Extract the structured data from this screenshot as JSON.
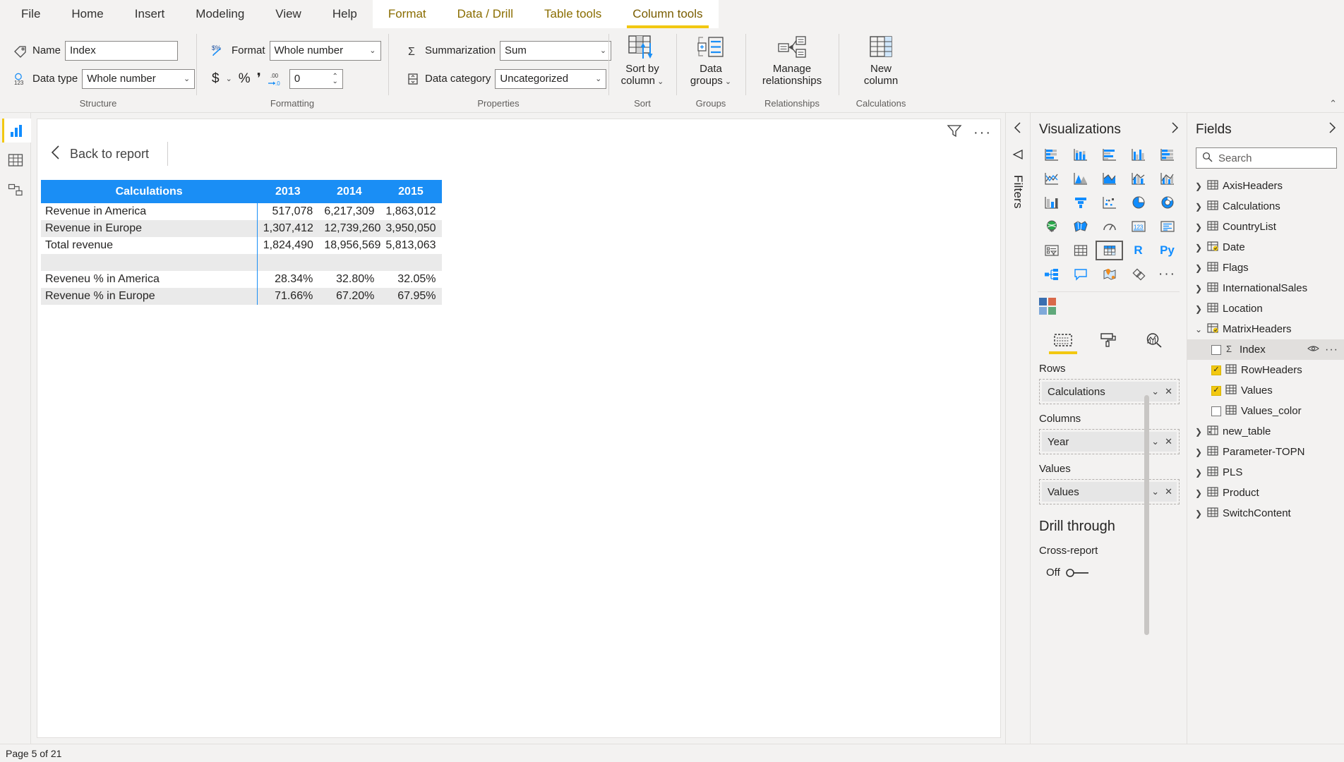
{
  "ribbon": {
    "tabs": [
      {
        "label": "File",
        "type": "normal",
        "active": false
      },
      {
        "label": "Home",
        "type": "normal",
        "active": false
      },
      {
        "label": "Insert",
        "type": "normal",
        "active": false
      },
      {
        "label": "Modeling",
        "type": "normal",
        "active": false
      },
      {
        "label": "View",
        "type": "normal",
        "active": false
      },
      {
        "label": "Help",
        "type": "normal",
        "active": false
      },
      {
        "label": "Format",
        "type": "contextual",
        "active": false
      },
      {
        "label": "Data / Drill",
        "type": "contextual",
        "active": false
      },
      {
        "label": "Table tools",
        "type": "contextual",
        "active": false
      },
      {
        "label": "Column tools",
        "type": "contextual",
        "active": true
      }
    ],
    "groups": {
      "structure": {
        "label": "Structure",
        "name_label": "Name",
        "name_value": "Index",
        "datatype_label": "Data type",
        "datatype_value": "Whole number"
      },
      "formatting": {
        "label": "Formatting",
        "format_label": "Format",
        "format_value": "Whole number",
        "currency_glyph": "$",
        "percent_glyph": "%",
        "thousands_glyph": "'",
        "decimal_glyph": ".00",
        "decimal_places_value": "0"
      },
      "properties": {
        "label": "Properties",
        "summarization_label": "Summarization",
        "summarization_value": "Sum",
        "datacategory_label": "Data category",
        "datacategory_value": "Uncategorized"
      },
      "sort": {
        "label": "Sort",
        "button_line1": "Sort by",
        "button_line2": "column"
      },
      "groups": {
        "label": "Groups",
        "button_line1": "Data",
        "button_line2": "groups"
      },
      "relationships": {
        "label": "Relationships",
        "button_line1": "Manage",
        "button_line2": "relationships"
      },
      "calculations": {
        "label": "Calculations",
        "button_line1": "New",
        "button_line2": "column"
      }
    }
  },
  "canvas": {
    "back_label": "Back to report",
    "matrix": {
      "headers": [
        "Calculations",
        "2013",
        "2014",
        "2015"
      ],
      "rows": [
        {
          "label": "Revenue in America",
          "values": [
            "517,078",
            "6,217,309",
            "1,863,012"
          ],
          "alt": false
        },
        {
          "label": "Revenue in Europe",
          "values": [
            "1,307,412",
            "12,739,260",
            "3,950,050"
          ],
          "alt": true
        },
        {
          "label": "Total revenue",
          "values": [
            "1,824,490",
            "18,956,569",
            "5,813,063"
          ],
          "alt": false
        },
        {
          "label": "",
          "values": [
            "",
            "",
            ""
          ],
          "alt": true
        },
        {
          "label": "Reveneu % in America",
          "values": [
            "28.34%",
            "32.80%",
            "32.05%"
          ],
          "alt": false
        },
        {
          "label": "Revenue % in Europe",
          "values": [
            "71.66%",
            "67.20%",
            "67.95%"
          ],
          "alt": true
        }
      ],
      "header_bg": "#1a8ef5",
      "alt_row_bg": "#eaeaea"
    }
  },
  "filters": {
    "label": "Filters"
  },
  "visualizations": {
    "title": "Visualizations",
    "icons": [
      "stacked-bar-chart-icon",
      "stacked-column-chart-icon",
      "clustered-bar-chart-icon",
      "clustered-column-chart-icon",
      "100-stacked-bar-chart-icon",
      "line-chart-icon",
      "area-chart-icon",
      "stacked-area-chart-icon",
      "line-and-stacked-column-chart-icon",
      "line-and-clustered-column-chart-icon",
      "ribbon-chart-icon",
      "waterfall-chart-icon",
      "scatter-chart-icon",
      "pie-chart-icon",
      "donut-chart-icon",
      "map-icon",
      "filled-map-icon",
      "gauge-icon",
      "card-icon",
      "multi-row-card-icon",
      "slicer-icon",
      "table-icon",
      "matrix-icon",
      "r-script-visual-icon",
      "python-visual-icon",
      "decomposition-tree-icon",
      "q-and-a-icon",
      "arcgis-map-icon",
      "paginated-report-icon",
      "more-visuals-icon"
    ],
    "selected_icon": "matrix-icon",
    "theme_label": "color-theme-swatch-icon",
    "field_tabs": [
      {
        "name": "fields-tab",
        "icon": "fields-well-icon",
        "active": true
      },
      {
        "name": "format-tab",
        "icon": "paint-roller-icon",
        "active": false
      },
      {
        "name": "analytics-tab",
        "icon": "analytics-magnifier-icon",
        "active": false
      }
    ],
    "wells": [
      {
        "label": "Rows",
        "chip": "Calculations"
      },
      {
        "label": "Columns",
        "chip": "Year"
      },
      {
        "label": "Values",
        "chip": "Values"
      }
    ],
    "drill": {
      "title": "Drill through",
      "cross_report_label": "Cross-report",
      "toggle_state": "Off"
    }
  },
  "fields": {
    "title": "Fields",
    "search_placeholder": "Search",
    "items": [
      {
        "label": "AxisHeaders",
        "level": 0,
        "expanded": false,
        "icon": "table-icon",
        "checked": null
      },
      {
        "label": "Calculations",
        "level": 0,
        "expanded": false,
        "icon": "table-icon",
        "checked": null
      },
      {
        "label": "CountryList",
        "level": 0,
        "expanded": false,
        "icon": "table-icon",
        "checked": null
      },
      {
        "label": "Date",
        "level": 0,
        "expanded": false,
        "icon": "date-table-icon",
        "checked": null
      },
      {
        "label": "Flags",
        "level": 0,
        "expanded": false,
        "icon": "table-icon",
        "checked": null
      },
      {
        "label": "InternationalSales",
        "level": 0,
        "expanded": false,
        "icon": "table-icon",
        "checked": null
      },
      {
        "label": "Location",
        "level": 0,
        "expanded": false,
        "icon": "table-icon",
        "checked": null
      },
      {
        "label": "MatrixHeaders",
        "level": 0,
        "expanded": true,
        "icon": "checked-table-icon",
        "checked": null
      },
      {
        "label": "Index",
        "level": 1,
        "expanded": null,
        "icon": "sigma-icon",
        "checked": false,
        "selected": true,
        "actions": true
      },
      {
        "label": "RowHeaders",
        "level": 1,
        "expanded": null,
        "icon": "column-icon",
        "checked": true
      },
      {
        "label": "Values",
        "level": 1,
        "expanded": null,
        "icon": "column-icon",
        "checked": true
      },
      {
        "label": "Values_color",
        "level": 1,
        "expanded": null,
        "icon": "column-icon",
        "checked": false
      },
      {
        "label": "new_table",
        "level": 0,
        "expanded": false,
        "icon": "calc-table-icon",
        "checked": null
      },
      {
        "label": "Parameter-TOPN",
        "level": 0,
        "expanded": false,
        "icon": "table-icon",
        "checked": null
      },
      {
        "label": "PLS",
        "level": 0,
        "expanded": false,
        "icon": "table-icon",
        "checked": null
      },
      {
        "label": "Product",
        "level": 0,
        "expanded": false,
        "icon": "table-icon",
        "checked": null
      },
      {
        "label": "SwitchContent",
        "level": 0,
        "expanded": false,
        "icon": "table-icon",
        "checked": null
      }
    ]
  },
  "status": {
    "page_indicator": "Page 5 of 21"
  },
  "colors": {
    "accent_yellow": "#f2c811",
    "contextual_tab_text": "#8a6d00",
    "matrix_header_blue": "#1a8ef5",
    "powerbi_blue": "#118dff"
  }
}
